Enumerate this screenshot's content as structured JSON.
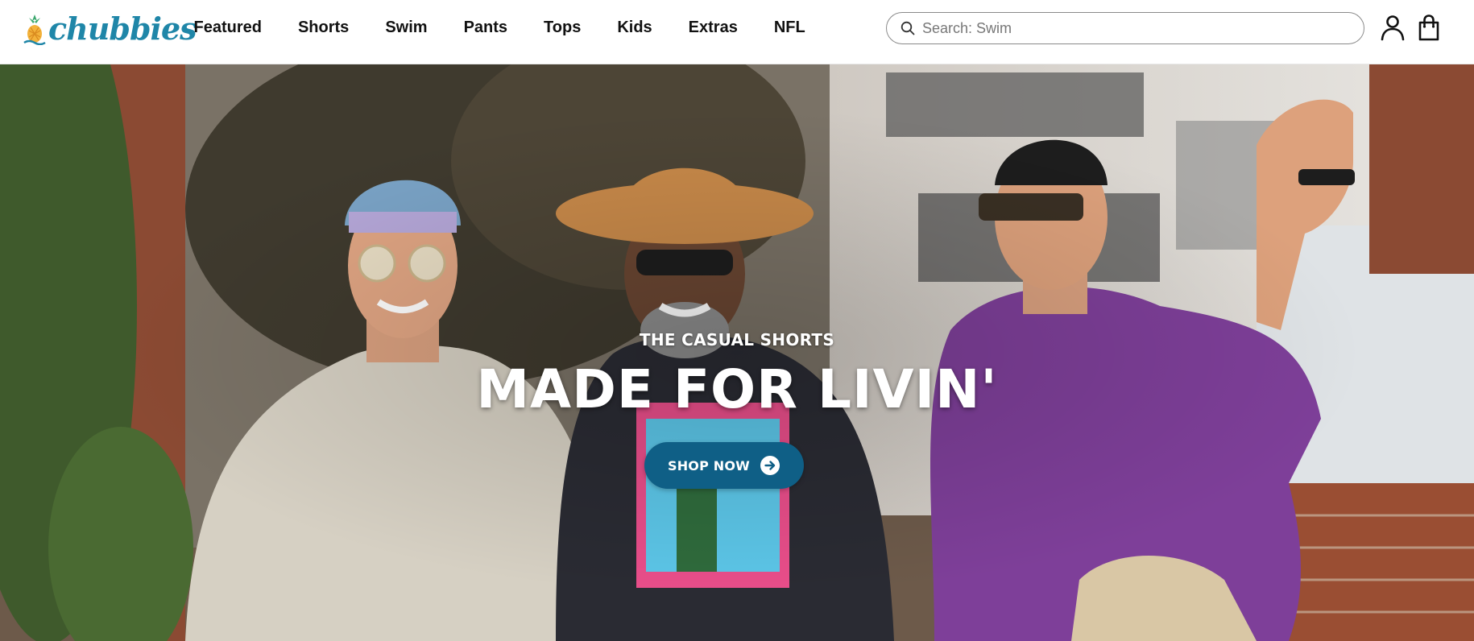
{
  "brand": {
    "name": "chubbies",
    "logo_icon": "pineapple-icon",
    "color": "#1f86a8"
  },
  "nav": {
    "items": [
      {
        "label": "Featured"
      },
      {
        "label": "Shorts"
      },
      {
        "label": "Swim"
      },
      {
        "label": "Pants"
      },
      {
        "label": "Tops"
      },
      {
        "label": "Kids"
      },
      {
        "label": "Extras"
      },
      {
        "label": "NFL"
      }
    ]
  },
  "search": {
    "placeholder": "Search: Swim",
    "value": "",
    "icon": "search-icon"
  },
  "header_icons": {
    "account": "account-icon",
    "cart": "shopping-bag-icon"
  },
  "hero": {
    "eyebrow": "THE CASUAL SHORTS",
    "headline": "MADE FOR LIVIN'",
    "cta_label": "SHOP NOW",
    "cta_icon": "arrow-right-circle-icon",
    "cta_color": "#0f5f86"
  }
}
